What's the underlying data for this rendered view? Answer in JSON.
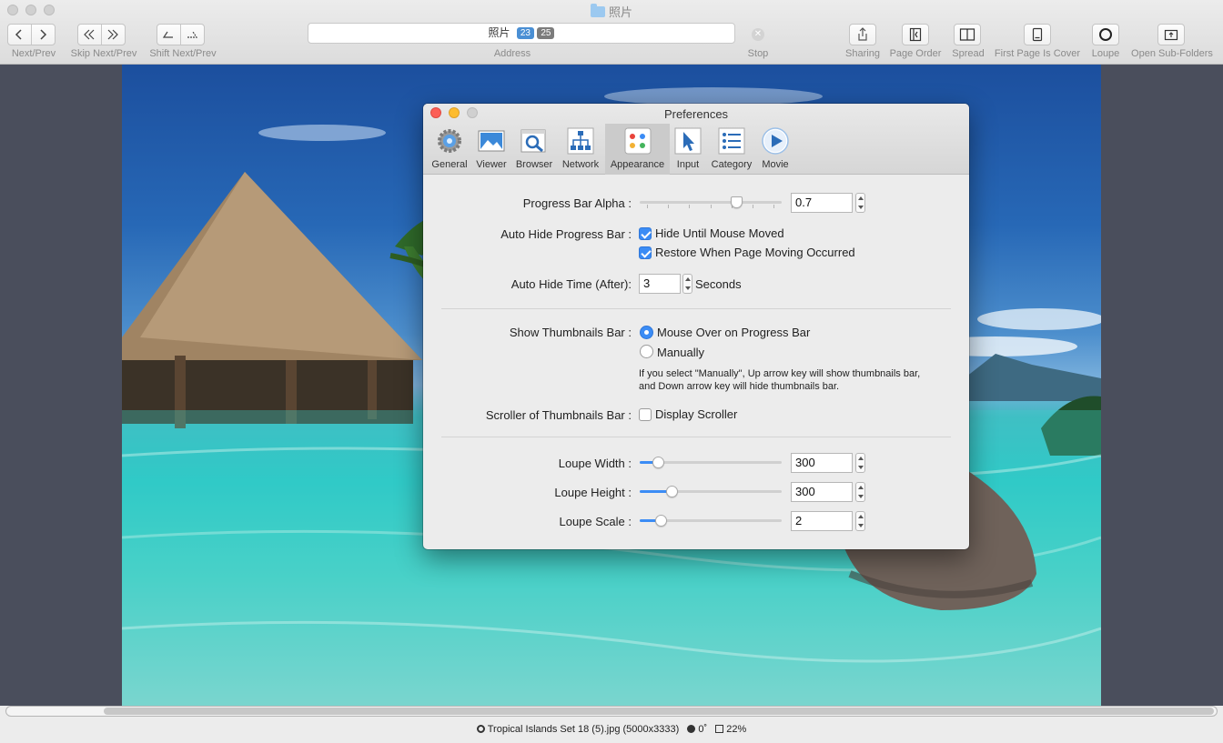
{
  "window": {
    "title": "照片"
  },
  "toolbar": {
    "next_prev_label": "Next/Prev",
    "skip_label": "Skip Next/Prev",
    "shift_label": "Shift Next/Prev",
    "address_label": "Address",
    "address_text": "照片",
    "address_badge_current": "23",
    "address_badge_total": "25",
    "stop_label": "Stop",
    "sharing_label": "Sharing",
    "page_order_label": "Page Order",
    "spread_label": "Spread",
    "first_page_cover_label": "First Page Is Cover",
    "loupe_label": "Loupe",
    "open_subfolders_label": "Open Sub-Folders"
  },
  "status": {
    "filename": "Tropical Islands Set 18 (5).jpg (5000x3333)",
    "rotation": "0˚",
    "zoom": "22%"
  },
  "preferences": {
    "title": "Preferences",
    "tabs": [
      {
        "label": "General",
        "icon": "gear-icon"
      },
      {
        "label": "Viewer",
        "icon": "image-icon"
      },
      {
        "label": "Browser",
        "icon": "magnifier-icon"
      },
      {
        "label": "Network",
        "icon": "network-icon"
      },
      {
        "label": "Appearance",
        "icon": "palette-icon",
        "selected": true
      },
      {
        "label": "Input",
        "icon": "cursor-icon"
      },
      {
        "label": "Category",
        "icon": "list-icon"
      },
      {
        "label": "Movie",
        "icon": "play-icon"
      }
    ],
    "progress_bar_alpha": {
      "label": "Progress Bar Alpha :",
      "value": "0.7",
      "slider_fraction": 0.7
    },
    "auto_hide_progress_bar": {
      "label": "Auto Hide Progress Bar :",
      "option1": {
        "label": "Hide Until Mouse Moved",
        "checked": true
      },
      "option2": {
        "label": "Restore When Page Moving Occurred",
        "checked": true
      }
    },
    "auto_hide_time": {
      "label": "Auto Hide Time (After):",
      "value": "3",
      "unit": "Seconds"
    },
    "show_thumbnails_bar": {
      "label": "Show Thumbnails Bar :",
      "option1": {
        "label": "Mouse Over on Progress Bar",
        "selected": true
      },
      "option2": {
        "label": "Manually",
        "selected": false
      },
      "note_line1": "If you select \"Manually\", Up arrow key will show thumbnails bar,",
      "note_line2": "and Down arrow key will hide thumbnails bar."
    },
    "scroller_thumbnails": {
      "label": "Scroller of Thumbnails Bar :",
      "option": "Display Scroller",
      "checked": false
    },
    "loupe_width": {
      "label": "Loupe Width :",
      "value": "300",
      "slider_fraction": 0.1
    },
    "loupe_height": {
      "label": "Loupe Height :",
      "value": "300",
      "slider_fraction": 0.2
    },
    "loupe_scale": {
      "label": "Loupe Scale :",
      "value": "2",
      "slider_fraction": 0.12
    }
  },
  "colors": {
    "accent": "#3b8cf5",
    "badge_current": "#4a8fd4",
    "badge_total": "#7c7c7c",
    "close_red": "#fc5f57",
    "minimize_yellow": "#fdbc2e",
    "content_background": "#4a4e5c"
  }
}
